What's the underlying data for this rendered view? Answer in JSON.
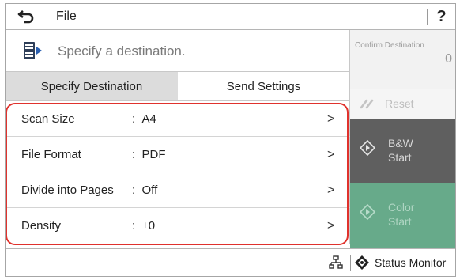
{
  "titlebar": {
    "title": "File",
    "help_label": "?"
  },
  "destination": {
    "placeholder_text": "Specify a destination."
  },
  "tabs": [
    {
      "label": "Specify Destination",
      "active": true
    },
    {
      "label": "Send Settings",
      "active": false
    }
  ],
  "settings": [
    {
      "label": "Scan Size",
      "value": "A4"
    },
    {
      "label": "File Format",
      "value": "PDF"
    },
    {
      "label": "Divide into Pages",
      "value": "Off"
    },
    {
      "label": "Density",
      "value": "±0"
    }
  ],
  "separator": ":",
  "chevron": ">",
  "right_panel": {
    "confirm_label": "Confirm Destination",
    "confirm_count": "0",
    "reset_label": "Reset",
    "bw_start": [
      "B&W",
      "Start"
    ],
    "color_start": [
      "Color",
      "Start"
    ]
  },
  "statusbar": {
    "status_monitor_label": "Status Monitor"
  },
  "colors": {
    "highlight": "#e0322d",
    "bw_button": "#5f5f5f",
    "color_button": "#67aa8a",
    "tab_active": "#dcdcdc"
  },
  "icons": [
    "back-arrow-icon",
    "destination-icon",
    "reset-icon",
    "start-diamond-icon",
    "network-icon",
    "status-monitor-icon"
  ]
}
